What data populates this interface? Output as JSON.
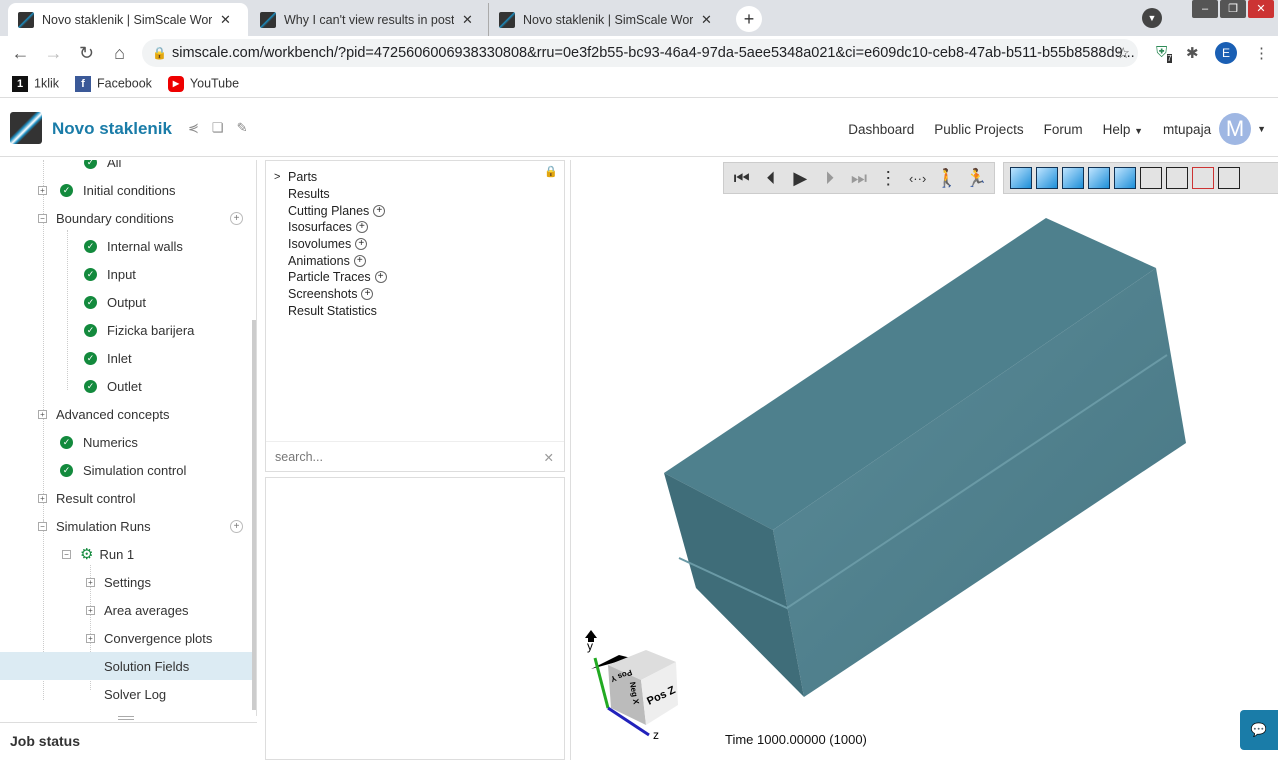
{
  "browser": {
    "tabs": [
      {
        "title": "Novo staklenik | SimScale Workbench",
        "active": true
      },
      {
        "title": "Why I can't view results in post processing",
        "active": false
      },
      {
        "title": "Novo staklenik | SimScale Workbench",
        "active": false
      }
    ],
    "url": "simscale.com/workbench/?pid=4725606006938330808&rru=0e3f2b55-bc93-46a4-97da-5aee5348a021&ci=e609dc10-ceb8-47ab-b511-b55b8588d9...",
    "profile": "E",
    "ext_badge": "7",
    "bookmarks": [
      "1klik",
      "Facebook",
      "YouTube"
    ]
  },
  "app": {
    "name": "Novo staklenik",
    "menu": [
      "Dashboard",
      "Public Projects",
      "Forum",
      "Help"
    ],
    "user": "mtupaja",
    "avatar": "M",
    "accent": "#1a7ca8"
  },
  "tree": {
    "items": [
      {
        "label": "All",
        "level": 3,
        "check": true
      },
      {
        "label": "Initial conditions",
        "level": 1,
        "check": true,
        "toggle": "+"
      },
      {
        "label": "Boundary conditions",
        "level": 1,
        "toggle": "-",
        "add": true
      },
      {
        "label": "Internal walls",
        "level": 2,
        "check": true
      },
      {
        "label": "Input",
        "level": 2,
        "check": true
      },
      {
        "label": "Output",
        "level": 2,
        "check": true
      },
      {
        "label": "Fizicka barijera",
        "level": 2,
        "check": true
      },
      {
        "label": "Inlet",
        "level": 2,
        "check": true
      },
      {
        "label": "Outlet",
        "level": 2,
        "check": true
      },
      {
        "label": "Advanced concepts",
        "level": 1,
        "toggle": "+"
      },
      {
        "label": "Numerics",
        "level": 1,
        "check": true
      },
      {
        "label": "Simulation control",
        "level": 1,
        "check": true
      },
      {
        "label": "Result control",
        "level": 1,
        "toggle": "+"
      },
      {
        "label": "Simulation Runs",
        "level": 1,
        "toggle": "-",
        "add": true
      },
      {
        "label": "Run 1",
        "level": 2,
        "toggle": "-",
        "gear": true
      },
      {
        "label": "Settings",
        "level": 3,
        "toggle": "+"
      },
      {
        "label": "Area averages",
        "level": 3,
        "toggle": "+"
      },
      {
        "label": "Convergence plots",
        "level": 3,
        "toggle": "+"
      },
      {
        "label": "Solution Fields",
        "level": 3,
        "selected": true
      },
      {
        "label": "Solver Log",
        "level": 3
      }
    ],
    "job_status": "Job status"
  },
  "post": {
    "items": [
      {
        "label": "Parts",
        "expand": true
      },
      {
        "label": "Results"
      },
      {
        "label": "Cutting Planes",
        "add": true
      },
      {
        "label": "Isosurfaces",
        "add": true
      },
      {
        "label": "Isovolumes",
        "add": true
      },
      {
        "label": "Animations",
        "add": true
      },
      {
        "label": "Particle Traces",
        "add": true
      },
      {
        "label": "Screenshots",
        "add": true
      },
      {
        "label": "Result Statistics"
      }
    ],
    "search_placeholder": "search..."
  },
  "viewer": {
    "time": "Time 1000.00000 (1000)",
    "cube_labels": [
      "Pos Z",
      "Pos Y",
      "Neg X"
    ],
    "axes": [
      "y",
      "z"
    ],
    "model_color": "#4d7f8c"
  }
}
